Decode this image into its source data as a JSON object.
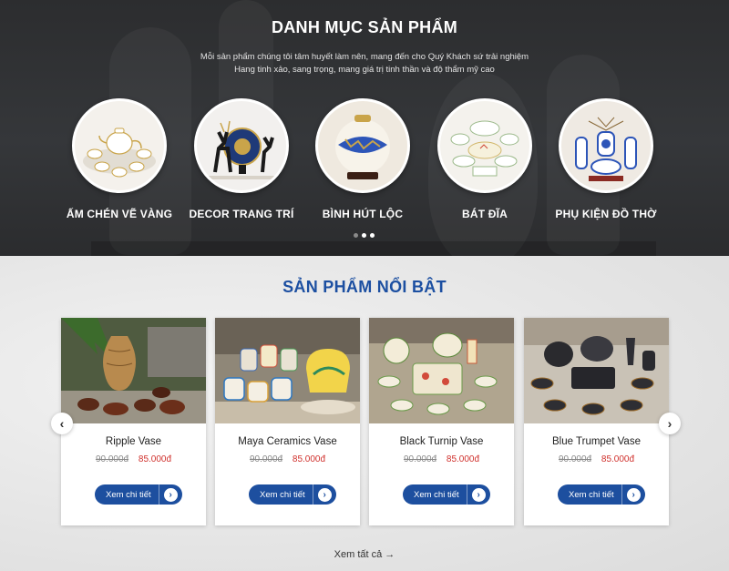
{
  "categories_section": {
    "title": "DANH MỤC SẢN PHẨM",
    "description_line1": "Mỗi sản phẩm chúng tôi tâm huyết làm nên, mang đến cho Quý Khách sứ trải nghiệm",
    "description_line2": "Hang tinh xảo, sang trọng, mang giá trị tinh thần và độ thẩm mỹ cao",
    "items": [
      {
        "label": "ẤM CHÉN VẼ VÀNG",
        "icon": "tea-set-gold-image"
      },
      {
        "label": "DECOR TRANG TRÍ",
        "icon": "deer-decor-image"
      },
      {
        "label": "BÌNH HÚT LỘC",
        "icon": "fortune-vase-image"
      },
      {
        "label": "BÁT ĐĨA",
        "icon": "bowls-plates-image"
      },
      {
        "label": "PHỤ KIỆN ĐỒ THỜ",
        "icon": "altar-accessories-image"
      }
    ],
    "carousel_dots": 3,
    "active_dot": 2
  },
  "featured_section": {
    "title": "SẢN PHẨM NỔI BẬT",
    "products": [
      {
        "name": "Ripple Vase",
        "old_price": "90.000đ",
        "new_price": "85.000đ",
        "button_label": "Xem chi tiết"
      },
      {
        "name": "Maya Ceramics Vase",
        "old_price": "90.000đ",
        "new_price": "85.000đ",
        "button_label": "Xem chi tiết"
      },
      {
        "name": "Black Turnip Vase",
        "old_price": "90.000đ",
        "new_price": "85.000đ",
        "button_label": "Xem chi tiết"
      },
      {
        "name": "Blue Trumpet Vase",
        "old_price": "90.000đ",
        "new_price": "85.000đ",
        "button_label": "Xem chi tiết"
      }
    ],
    "prev_icon": "chevron-left-icon",
    "next_icon": "chevron-right-icon",
    "view_all_label": "Xem tất cả →"
  },
  "colors": {
    "brand_blue": "#1d4f9f",
    "sale_red": "#d0312d",
    "banner_dark": "#2c2d2f"
  }
}
